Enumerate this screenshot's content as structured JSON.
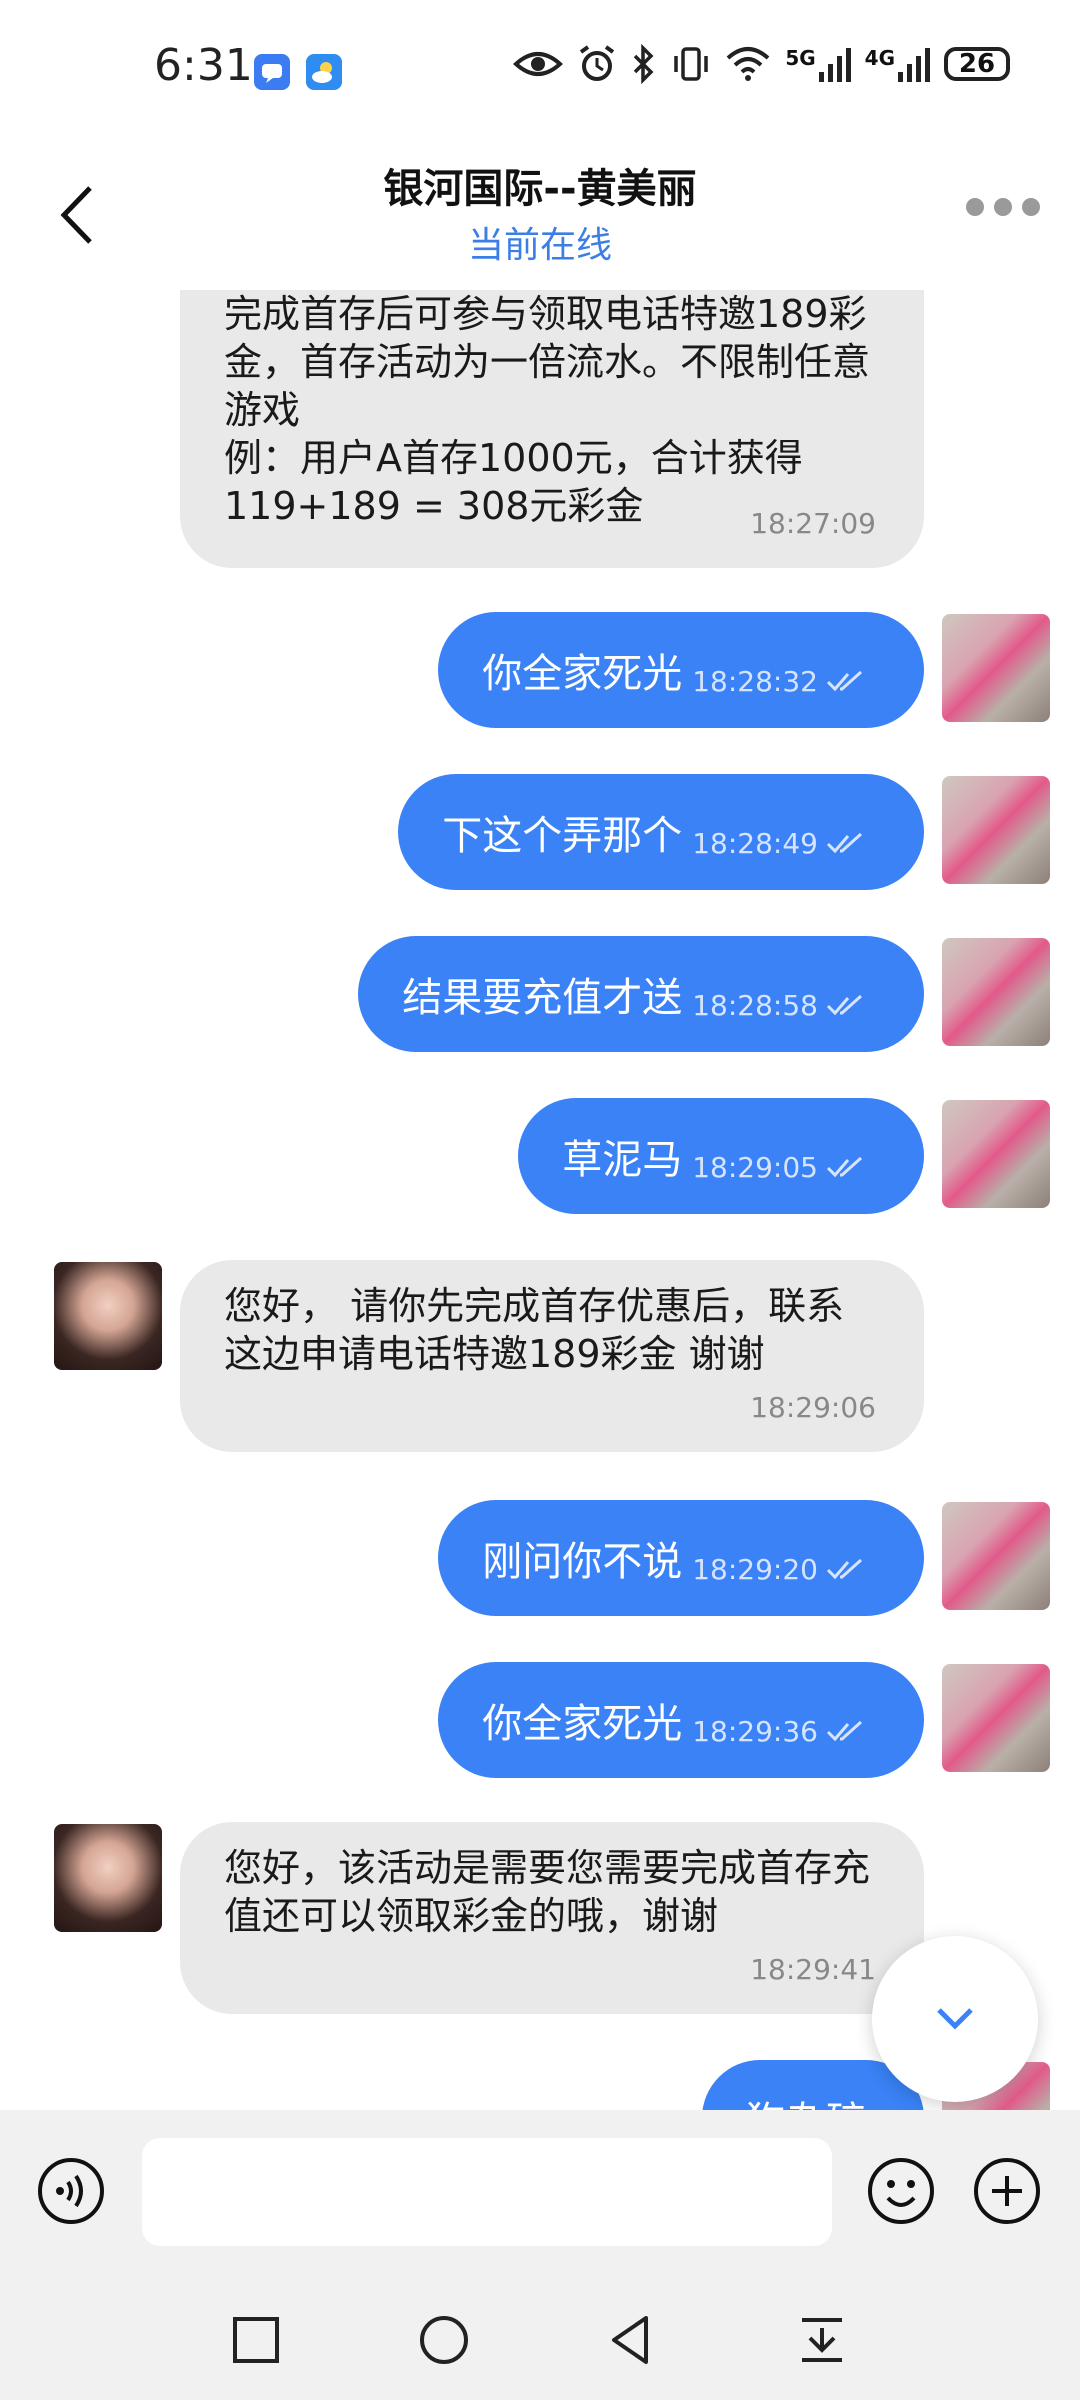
{
  "status_bar": {
    "time": "6:31",
    "network_1": "5G",
    "network_2": "4G",
    "battery": "26"
  },
  "header": {
    "title": "银河国际--黄美丽",
    "status": "当前在线"
  },
  "messages": [
    {
      "side": "in",
      "text": "完成首存后可参与领取电话特邀189彩金，首存活动为一倍流水。不限制任意游戏\n例：用户A首存1000元，合计获得119+189 = 308元彩金",
      "time": "18:27:09"
    },
    {
      "side": "out",
      "text": "你全家死光",
      "time": "18:28:32"
    },
    {
      "side": "out",
      "text": "下这个弄那个",
      "time": "18:28:49"
    },
    {
      "side": "out",
      "text": "结果要充值才送",
      "time": "18:28:58"
    },
    {
      "side": "out",
      "text": "草泥马",
      "time": "18:29:05"
    },
    {
      "side": "in",
      "text": "您好， 请你先完成首存优惠后，联系这边申请电话特邀189彩金 谢谢",
      "time": "18:29:06"
    },
    {
      "side": "out",
      "text": "刚问你不说",
      "time": "18:29:20"
    },
    {
      "side": "out",
      "text": "你全家死光",
      "time": "18:29:36"
    },
    {
      "side": "in",
      "text": "您好，该活动是需要您需要完成首存充值还可以领取彩金的哦，谢谢",
      "time": "18:29:41"
    },
    {
      "side": "out",
      "text": "狗杂碎",
      "time": ""
    }
  ],
  "input": {
    "value": "",
    "placeholder": ""
  },
  "colors": {
    "accent": "#3a82f6",
    "incoming_bubble": "#e9e9e9",
    "status_text": "#3c7ee6"
  },
  "icons": [
    "back-arrow-icon",
    "more-dots-icon",
    "voice-icon",
    "emoji-icon",
    "plus-icon",
    "chevron-down-icon",
    "double-check-icon",
    "recent-apps-icon",
    "home-icon",
    "back-icon",
    "notification-shade-icon"
  ]
}
